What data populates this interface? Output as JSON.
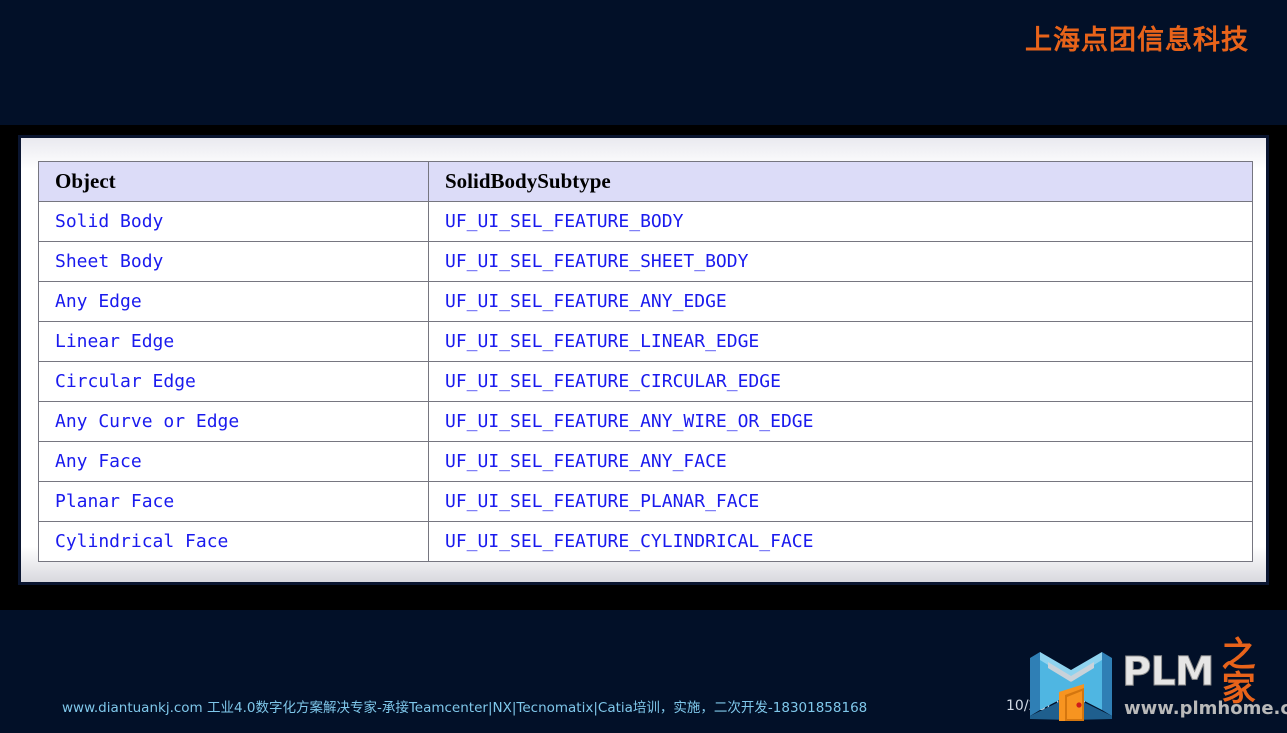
{
  "slide": {
    "background_color": "#021028",
    "brand_title": "上海点团信息科技",
    "brand_color": "#e8631a"
  },
  "table": {
    "header_bg": "#dcdcf8",
    "text_color": "#1a1aee",
    "columns": [
      "Object",
      "SolidBodySubtype"
    ],
    "rows": [
      {
        "object": "Solid Body",
        "subtype": "UF_UI_SEL_FEATURE_BODY"
      },
      {
        "object": "Sheet Body",
        "subtype": "UF_UI_SEL_FEATURE_SHEET_BODY"
      },
      {
        "object": "Any Edge",
        "subtype": "UF_UI_SEL_FEATURE_ANY_EDGE"
      },
      {
        "object": "Linear Edge",
        "subtype": "UF_UI_SEL_FEATURE_LINEAR_EDGE"
      },
      {
        "object": "Circular Edge",
        "subtype": "UF_UI_SEL_FEATURE_CIRCULAR_EDGE"
      },
      {
        "object": "Any Curve or Edge",
        "subtype": "UF_UI_SEL_FEATURE_ANY_WIRE_OR_EDGE"
      },
      {
        "object": "Any Face",
        "subtype": "UF_UI_SEL_FEATURE_ANY_FACE"
      },
      {
        "object": "Planar Face",
        "subtype": "UF_UI_SEL_FEATURE_PLANAR_FACE"
      },
      {
        "object": "Cylindrical Face",
        "subtype": "UF_UI_SEL_FEATURE_CYLINDRICAL_FACE"
      }
    ]
  },
  "footer": {
    "note": "www.diantuankj.com 工业4.0数字化方案解决专家-承接Teamcenter|NX|Tecnomatix|Catia培训，实施，二次开发-18301858168",
    "note_color": "#7fc7ea",
    "date": "10/25/2017"
  },
  "logo": {
    "mark_name": "plm-book-mark-icon",
    "letters": "PLM",
    "suffix": "之家",
    "url": "www.plmhome.com",
    "mark_color": "#3fa8dc",
    "door_color": "#f79420"
  }
}
